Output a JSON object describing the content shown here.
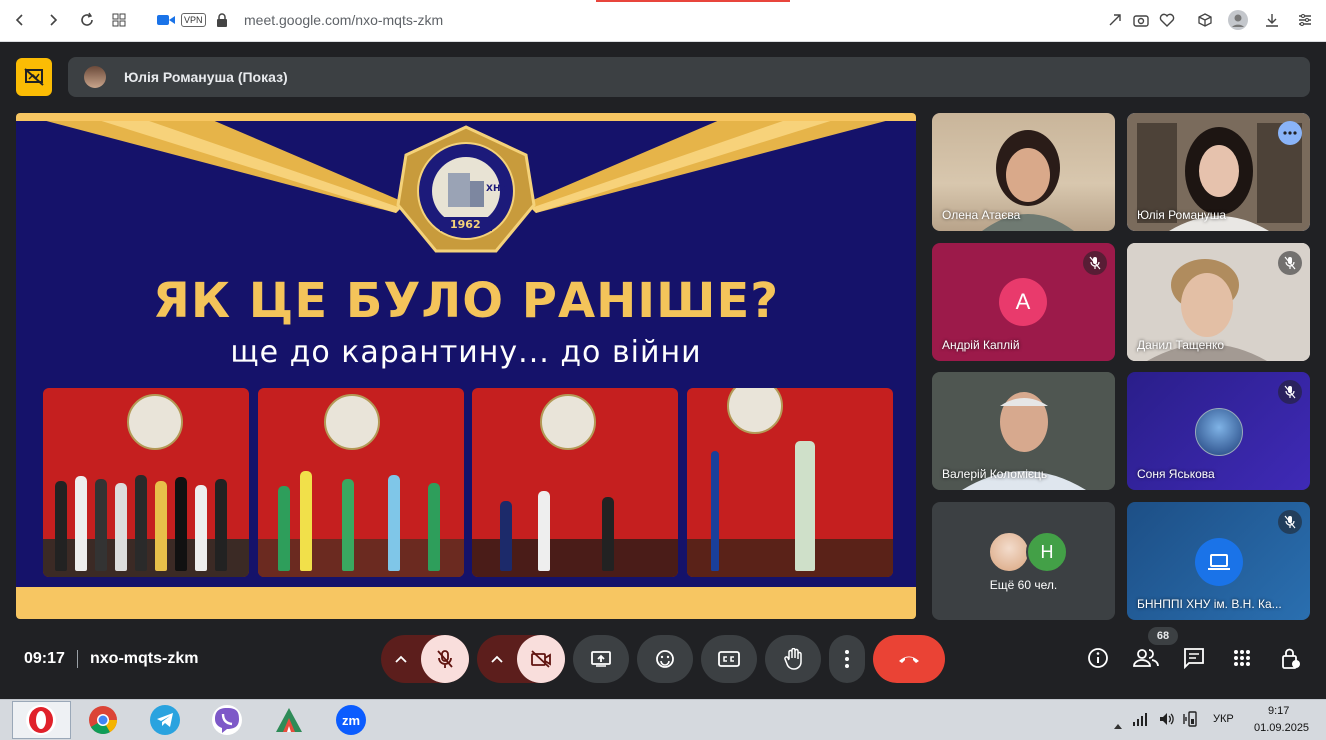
{
  "browser": {
    "url": "meet.google.com/nxo-mqts-zkm",
    "vpn_label": "VPN"
  },
  "presenter": {
    "name": "Юлія Романуша (Показ)"
  },
  "slide": {
    "title": "ЯК ЦЕ БУЛО РАНІШЕ?",
    "subtitle": "ще до карантину... до війни",
    "emblem_text": "ХНУ",
    "emblem_year": "1962"
  },
  "participants": [
    {
      "name": "Олена Атаєва",
      "muted": false
    },
    {
      "name": "Юлія Романуша",
      "muted": false
    },
    {
      "name": "Андрій Каплій",
      "initial": "А",
      "muted": true
    },
    {
      "name": "Данил Тащенко",
      "muted": true
    },
    {
      "name": "Валерій Коломієць",
      "muted": false
    },
    {
      "name": "Соня Яськова",
      "muted": true
    },
    {
      "name": "Ещё 60 чел.",
      "initial": "Н"
    },
    {
      "name": "БННППІ ХНУ ім. В.Н. Ка...",
      "muted": true
    }
  ],
  "meeting": {
    "time": "09:17",
    "code": "nxo-mqts-zkm",
    "people_count": "68"
  },
  "taskbar": {
    "lang": "УКР",
    "time": "9:17",
    "date": "01.09.2025",
    "apps": [
      "Opera",
      "Chrome",
      "Telegram",
      "Viber",
      "Media",
      "Zoom"
    ],
    "zoom_label": "zm"
  },
  "colors": {
    "meet_bg": "#202124",
    "slide_navy": "#15126a",
    "slide_gold": "#f4c45a",
    "end_call": "#ea4335",
    "muted_btn": "#f9dedc"
  }
}
